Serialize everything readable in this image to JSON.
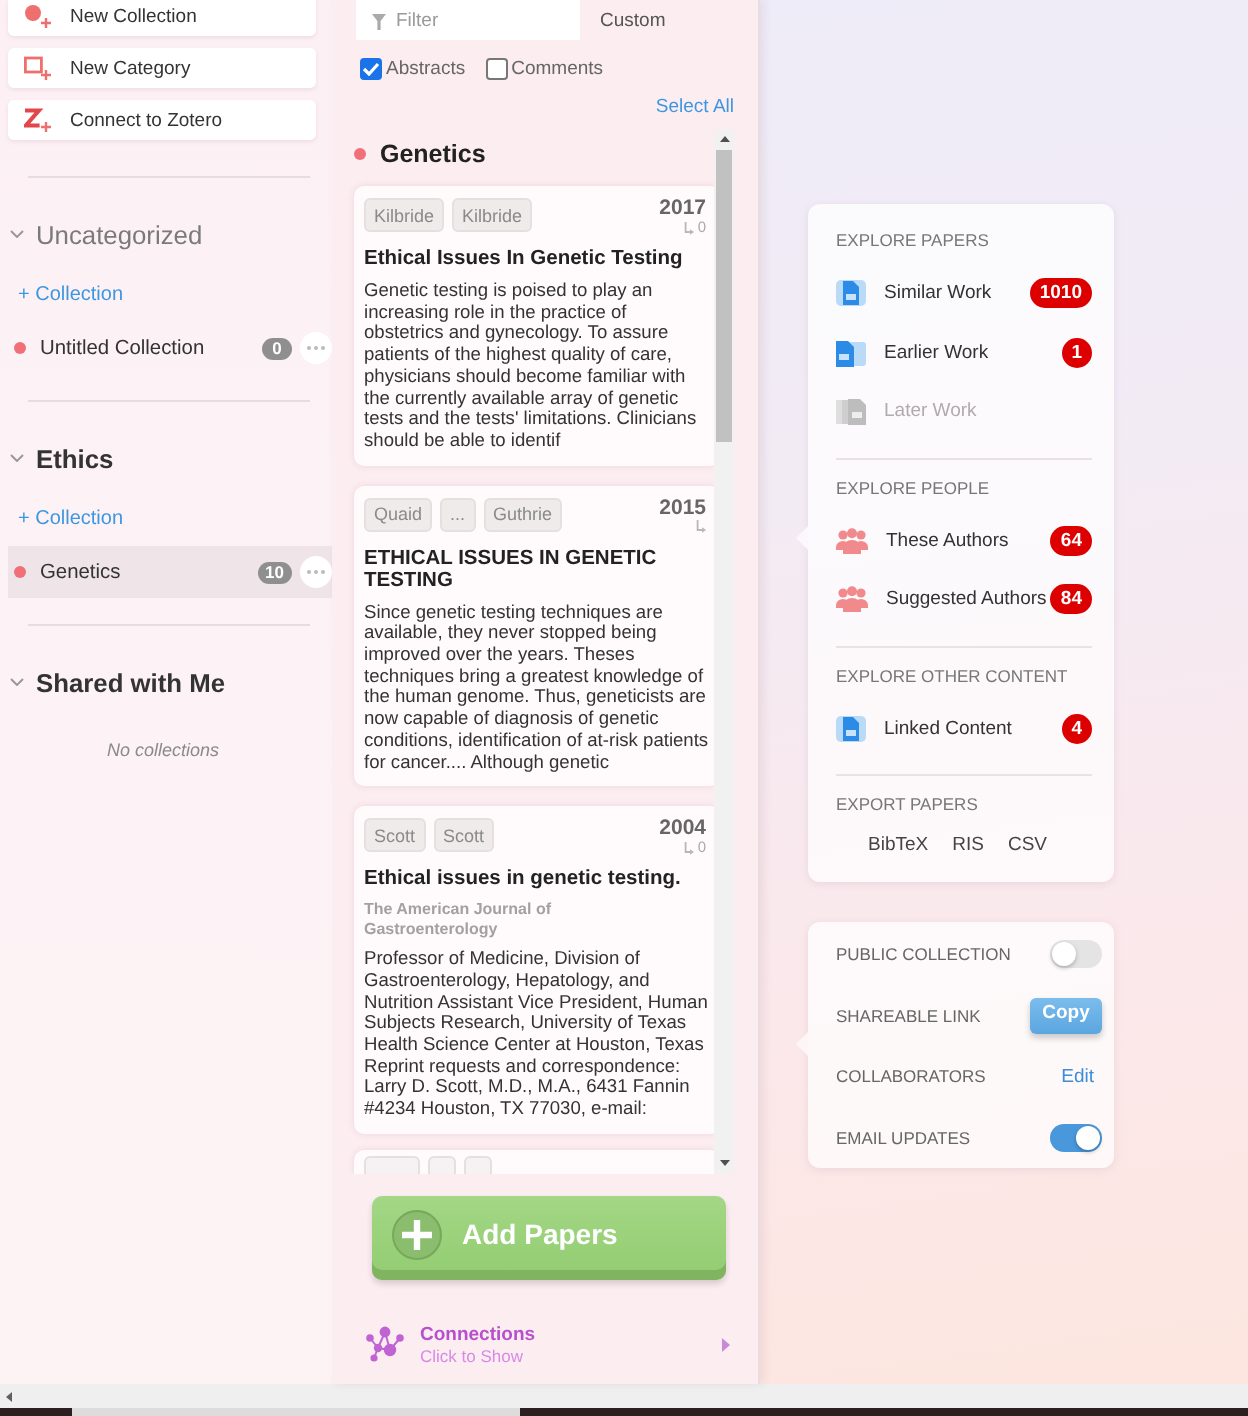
{
  "sidebar": {
    "actions": [
      {
        "kind": "collection",
        "label": "New Collection"
      },
      {
        "kind": "category",
        "label": "New Category"
      },
      {
        "kind": "zotero",
        "label": "Connect to Zotero"
      }
    ],
    "categories": [
      {
        "kind": "uncategorized",
        "title": "Uncategorized",
        "expanded": true,
        "add_label": "+ Collection",
        "collections": [
          {
            "name": "Untitled Collection",
            "count": "0",
            "color": "#f0707a",
            "selected": false
          }
        ]
      },
      {
        "kind": "named",
        "title": "Ethics",
        "expanded": true,
        "add_label": "+ Collection",
        "collections": [
          {
            "name": "Genetics",
            "count": "10",
            "color": "#f0707a",
            "selected": true
          }
        ]
      },
      {
        "kind": "shared",
        "title": "Shared with Me",
        "expanded": true,
        "empty_text": "No collections"
      }
    ]
  },
  "papers": {
    "filter": {
      "placeholder": "Filter",
      "mode": "Custom"
    },
    "options": [
      {
        "label": "Abstracts",
        "checked": true
      },
      {
        "label": "Comments",
        "checked": false
      }
    ],
    "select_all": "Select All",
    "collection": {
      "name": "Genetics",
      "color": "#f0707a"
    },
    "items": [
      {
        "kind": "full",
        "authors": [
          "Kilbride",
          "Kilbride"
        ],
        "year": "2017",
        "citations": "0",
        "title": "Ethical Issues In Genetic Testing",
        "abstract": "Genetic testing is poised to play an increasing role in the practice of obstetrics and gynecology. To assure patients of the highest quality of care, physicians should become familiar with the currently available array of genetic tests and the tests' limitations. Clinicians should be able to identif"
      },
      {
        "kind": "full",
        "authors": [
          "Quaid",
          "...",
          "Guthrie"
        ],
        "year": "2015",
        "title": "ETHICAL ISSUES IN GENETIC TESTING",
        "abstract": "Since genetic testing techniques are available, they never stopped being improved over the years. Theses techniques bring a greatest knowledge of the human genome. Thus, geneticists are now capable of diagnosis of genetic conditions, identification of at-risk patients for cancer.... Although genetic"
      },
      {
        "kind": "full",
        "authors": [
          "Scott",
          "Scott"
        ],
        "year": "2004",
        "citations": "0",
        "title": "Ethical issues in genetic testing.",
        "journal": "The American Journal of Gastroenterology",
        "abstract": "Professor of Medicine, Division of Gastroenterology, Hepatology, and Nutrition Assistant Vice President, Human Subjects Research, University of Texas Health Science Center at Houston, Texas Reprint requests and correspondence: Larry D. Scott, M.D., M.A., 6431 Fannin #4234 Houston, TX 77030, e-mail:"
      },
      {
        "kind": "cut"
      }
    ],
    "add_button": "Add Papers",
    "connections": {
      "title": "Connections",
      "subtitle": "Click to Show"
    }
  },
  "explore": {
    "sections": [
      {
        "heading": "EXPLORE PAPERS",
        "items": [
          {
            "kind": "document",
            "label": "Similar Work",
            "count": "1010",
            "disabled": false
          },
          {
            "kind": "earlier",
            "label": "Earlier Work",
            "count": "1",
            "disabled": false
          },
          {
            "kind": "later",
            "label": "Later Work",
            "disabled": true
          }
        ]
      },
      {
        "heading": "EXPLORE PEOPLE",
        "items": [
          {
            "kind": "people",
            "label": "These Authors",
            "count": "64",
            "disabled": false
          },
          {
            "kind": "people",
            "label": "Suggested Authors",
            "count": "84",
            "disabled": false
          }
        ]
      },
      {
        "heading": "EXPLORE OTHER CONTENT",
        "items": [
          {
            "kind": "document",
            "label": "Linked Content",
            "count": "4",
            "disabled": false
          }
        ]
      }
    ],
    "export": {
      "heading": "EXPORT PAPERS",
      "formats": [
        "BibTeX",
        "RIS",
        "CSV"
      ]
    }
  },
  "settings": [
    {
      "kind": "toggle",
      "label": "PUBLIC COLLECTION",
      "on": false
    },
    {
      "kind": "button",
      "label": "SHAREABLE LINK",
      "action": "Copy"
    },
    {
      "kind": "link",
      "label": "COLLABORATORS",
      "action": "Edit"
    },
    {
      "kind": "toggle",
      "label": "EMAIL UPDATES",
      "on": true
    }
  ]
}
